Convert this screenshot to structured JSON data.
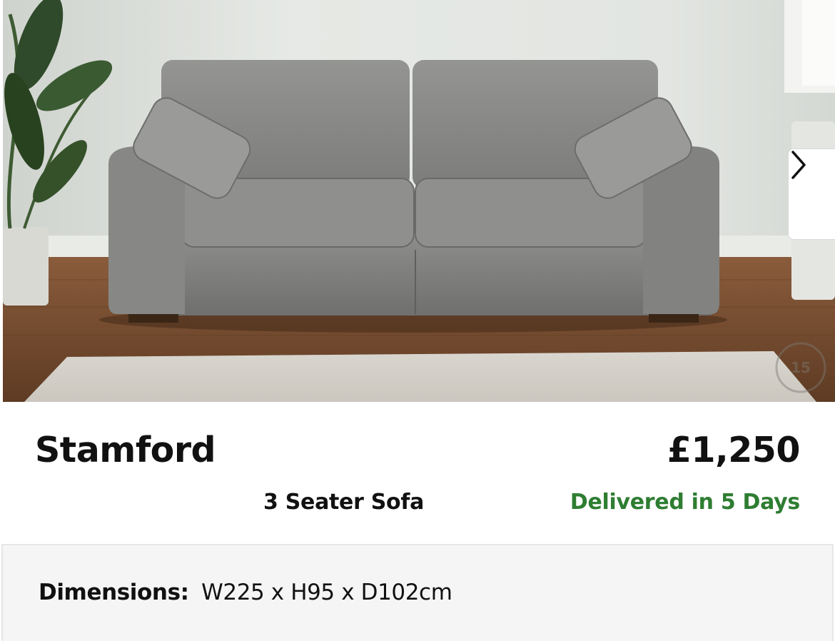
{
  "product": {
    "image": {
      "alt": "Grey fabric 3 seater sofa in a living room",
      "badge_text": "15"
    },
    "carousel": {
      "next_icon": "chevron-right-icon"
    },
    "name": "Stamford",
    "price": "£1,250",
    "type": "3 Seater Sofa",
    "delivery": "Delivered in 5 Days",
    "dimensions": {
      "label": "Dimensions:",
      "value": "W225 x H95 x D102cm"
    }
  },
  "colors": {
    "delivery_green": "#2e7d32",
    "text": "#111111",
    "panel_bg": "#f5f5f5"
  }
}
